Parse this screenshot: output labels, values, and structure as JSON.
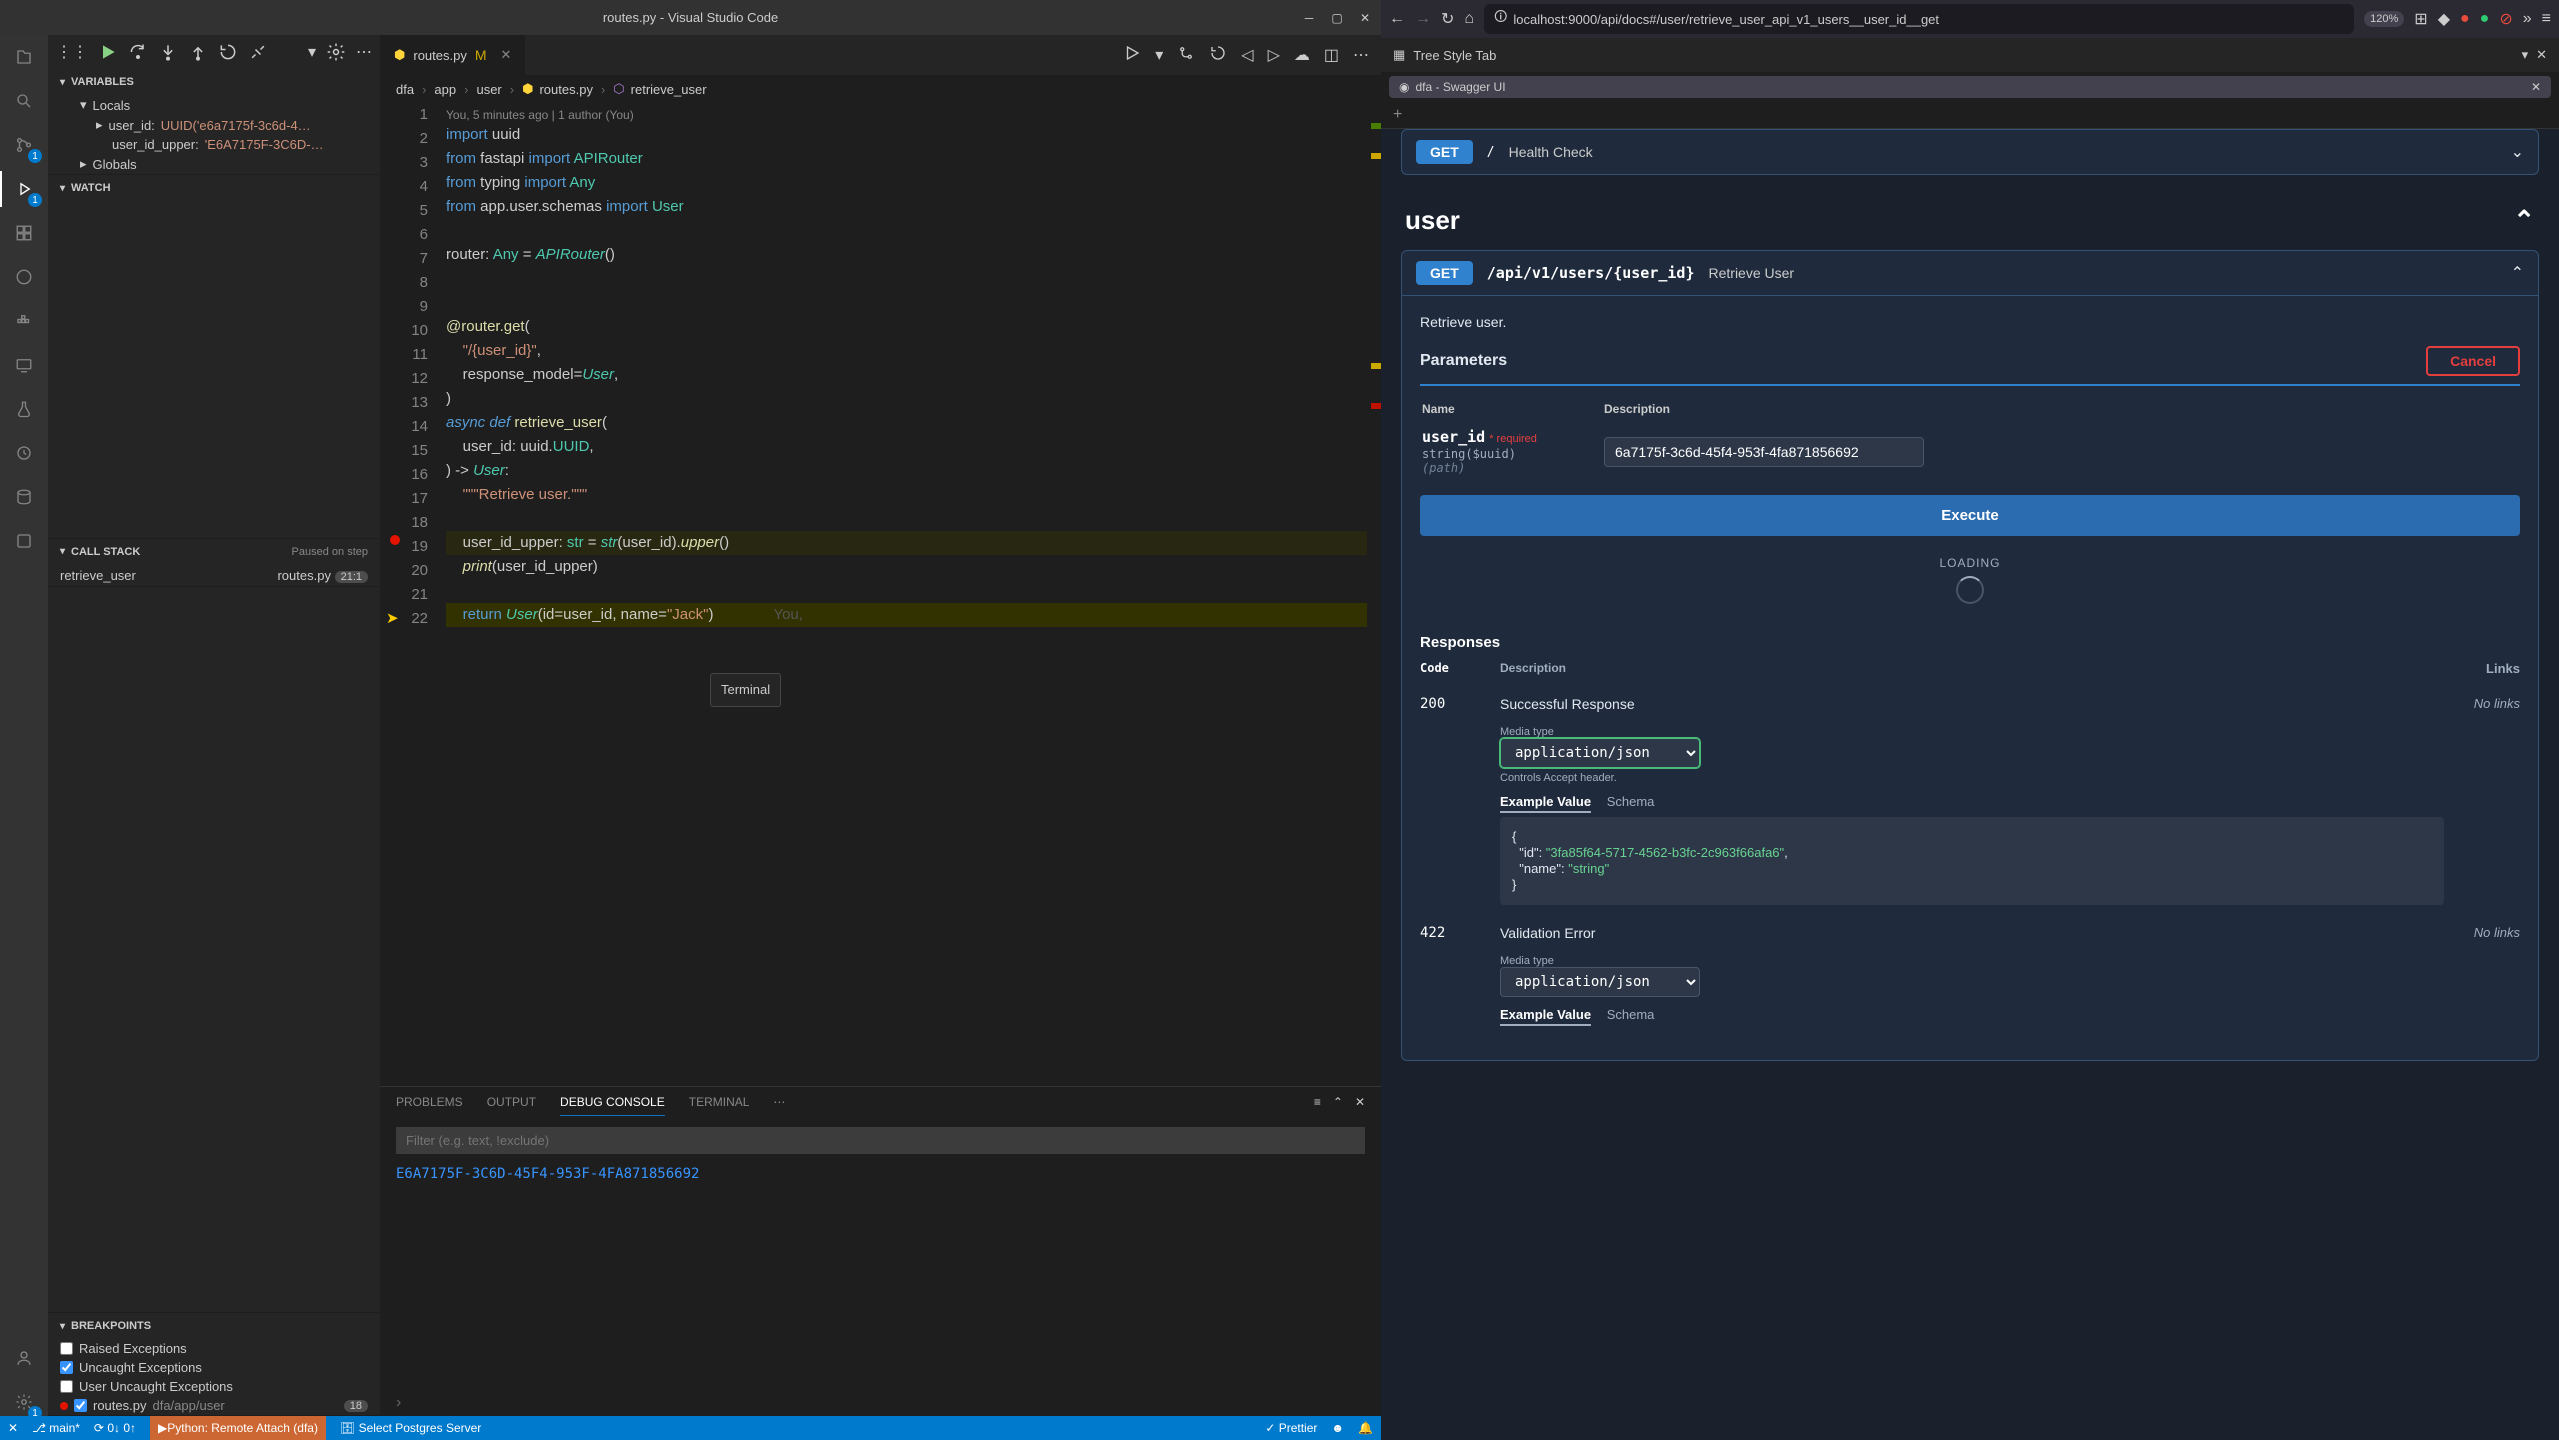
{
  "vscode": {
    "title": "routes.py - Visual Studio Code",
    "tab": {
      "name": "routes.py",
      "modified": "M"
    },
    "breadcrumb": [
      "dfa",
      "app",
      "user",
      "routes.py",
      "retrieve_user"
    ],
    "codelens": "You, 5 minutes ago | 1 author (You)",
    "lines": [
      "import uuid",
      "from fastapi import APIRouter",
      "from typing import Any",
      "from app.user.schemas import User",
      "",
      "router: Any = APIRouter()",
      "",
      "",
      "@router.get(",
      "    \"/{user_id}\",",
      "    response_model=User,",
      ")",
      "async def retrieve_user(",
      "    user_id: uuid.UUID,",
      ") -> User:",
      "    \"\"\"Retrieve user.\"\"\"",
      "",
      "    user_id_upper: str = str(user_id).upper()",
      "    print(user_id_upper)",
      "",
      "    return User(id=user_id, name=\"Jack\")",
      ""
    ],
    "inline_author": "You,",
    "tooltip": "Terminal",
    "panel": {
      "tabs": [
        "PROBLEMS",
        "OUTPUT",
        "DEBUG CONSOLE",
        "TERMINAL"
      ],
      "filter_placeholder": "Filter (e.g. text, !exclude)",
      "output": "E6A7175F-3C6D-45F4-953F-4FA871856692"
    },
    "variables": {
      "header": "VARIABLES",
      "locals": "Locals",
      "globals": "Globals",
      "user_id_label": "user_id:",
      "user_id_val": "UUID('e6a7175f-3c6d-4…",
      "upper_label806": "user_id_upper:",
      "upper_val": "'E6A7175F-3C6D-…"
    },
    "watch": "WATCH",
    "callstack": {
      "header": "CALL STACK",
      "status": "Paused on step",
      "frame": "retrieve_user",
      "file": "routes.py",
      "pos": "21:1"
    },
    "breakpoints": {
      "header": "BREAKPOINTS",
      "items": [
        "Raised Exceptions",
        "Uncaught Exceptions",
        "User Uncaught Exceptions"
      ],
      "file": "routes.py",
      "file_path": "dfa/app/user",
      "line_badge": "18"
    },
    "status": {
      "branch": "main*",
      "sync": "0↓ 0↑",
      "remote": "Python: Remote Attach (dfa)",
      "postgres": "Select Postgres Server",
      "prettier": "Prettier"
    }
  },
  "browser": {
    "url": "localhost:9000/api/docs#/user/retrieve_user_api_v1_users__user_id__get",
    "zoom": "120%",
    "tabpanel": "Tree Style Tab",
    "tab": "dfa - Swagger UI",
    "health": {
      "method": "GET",
      "summary": "Health Check"
    },
    "tag": "user",
    "op": {
      "method": "GET",
      "path": "/api/v1/users/{user_id}",
      "summary": "Retrieve User",
      "desc": "Retrieve user.",
      "params_label": "Parameters",
      "cancel": "Cancel",
      "col_name": "Name",
      "col_desc": "Description",
      "param_name": "user_id",
      "required": "* required",
      "param_type": "string($uuid)",
      "param_in": "(path)",
      "param_value": "6a7175f-3c6d-45f4-953f-4fa871856692",
      "execute": "Execute",
      "loading": "LOADING"
    },
    "responses": {
      "header": "Responses",
      "col_code": "Code",
      "col_desc": "Description",
      "col_links": "Links",
      "r200": {
        "code": "200",
        "desc": "Successful Response",
        "links": "No links"
      },
      "r422": {
        "code": "422",
        "desc": "Validation Error",
        "links": "No links"
      },
      "media_label": "Media type",
      "media": "application/json",
      "controls": "Controls Accept header.",
      "example_tab": "Example Value",
      "schema_tab": "Schema",
      "sample_id": "\"3fa85f64-5717-4562-b3fc-2c963f66afa6\"",
      "sample_name": "\"string\""
    }
  }
}
